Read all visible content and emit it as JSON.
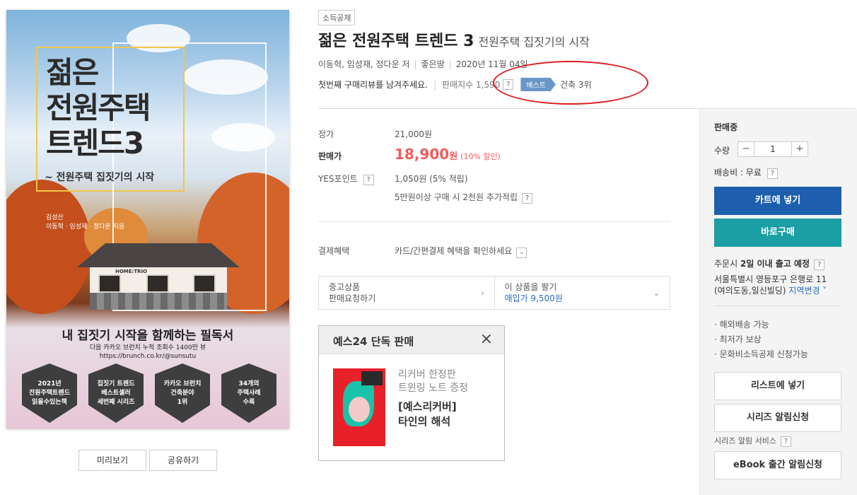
{
  "cover": {
    "title_line1": "젊은",
    "title_line2": "전원주택",
    "title_line3": "트렌드3",
    "subtitle": "~ 전원주택 집짓기의 시작",
    "authors_label": "김성산",
    "authors": "이동혁 · 임성재 · 정다운 지음",
    "house_sign": "HOME:TRIO",
    "tagline": "내 집짓기 시작을 함께하는 필독서",
    "tagline_small_1": "다음 카카오 브런치 누적 조회수 1400만 뷰",
    "tagline_small_2": "https://brunch.co.kr/@sunsutu",
    "badges": [
      "2021년\n전원주택트렌드\n읽을수있는책",
      "집짓기 트렌드\n베스트셀러\n세번째 시리즈",
      "카카오 브런치\n건축분야\n1위",
      "34개의\n주택사례\n수록"
    ]
  },
  "left_buttons": {
    "preview": "미리보기",
    "share": "공유하기"
  },
  "product": {
    "tag": "소득공제",
    "title": "젊은 전원주택 트렌드 3",
    "subtitle": "전원주택 집짓기의 시작",
    "authors": "이동혁, 임성재, 정다운 저",
    "publisher": "좋은땅",
    "date": "2020년 11월 04일",
    "review_prompt": "첫번째 구매리뷰를 남겨주세요.",
    "sales_index": "판매지수 1,590",
    "q": "?",
    "best_label": "베스트",
    "best_rank": "건축 3위"
  },
  "price": {
    "list_label": "정가",
    "list_value": "21,000원",
    "sale_label": "판매가",
    "sale_value": "18,900",
    "sale_unit": "원",
    "sale_discount": "(10% 할인)",
    "point_label": "YES포인트",
    "point_value": "1,050원 (5% 적립)",
    "extra_point": "5만원이상 구매 시 2천원 추가적립",
    "pay_label": "결제혜택",
    "pay_value": "카드/간편결제 혜택을 확인하세요",
    "dropdown": "⌄"
  },
  "used": {
    "left_line1": "중고상품",
    "left_line2": "판매요청하기",
    "left_chev": "›",
    "right_line1": "이 상품을 팔기",
    "right_line2": "매입가 9,500원",
    "right_chev": "⌄"
  },
  "exclusive": {
    "heading": "예스24 단독 판매",
    "close": "×",
    "line1": "리커버 한정판",
    "line2": "트윈링 노트 증정",
    "line3": "[예스리커버]",
    "line4": "타인의 해석"
  },
  "panel": {
    "status": "판매중",
    "qty_label": "수량",
    "minus": "−",
    "qty": "1",
    "plus": "+",
    "shipping": "배송비 : 무료",
    "cart": "카트에 넣기",
    "buy_now": "바로구매",
    "delivery_prefix": "주문시 ",
    "delivery_strong": "2일 이내 출고 예정",
    "address_line1": "서울특별시 영등포구 은행로 11",
    "address_line2": "(여의도동,일신빌딩) ",
    "change_region": "지역변경 ˅",
    "bullets": [
      "· 해외배송 가능",
      "· 최저가 보상",
      "· 문화비소득공제 신청가능"
    ],
    "wishlist": "리스트에 넣기",
    "series_alert": "시리즈 알림신청",
    "series_service": "시리즈 알림 서비스",
    "ebook_alert": "eBook 출간 알림신청"
  },
  "colors": {
    "sale": "#f25c5c",
    "cart": "#1d5fac",
    "buy": "#1b9ea4",
    "annotation": "#e0191c"
  }
}
